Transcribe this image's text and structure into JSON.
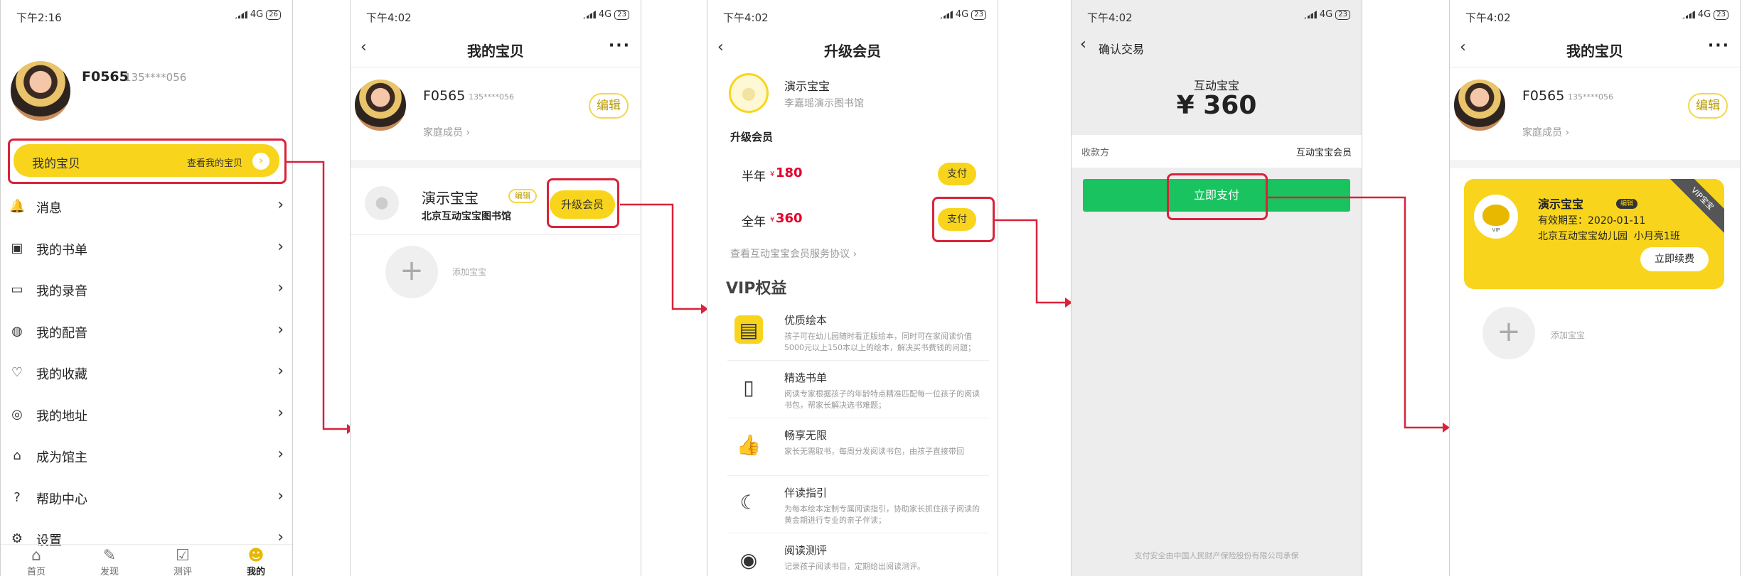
{
  "colors": {
    "accent": "#f8d51c",
    "highlight": "#d8233a",
    "pay": "#19c360",
    "price": "#e4002b"
  },
  "status": {
    "carrier": "4G",
    "s1_time": "下午2:16",
    "s1_battery": "26",
    "time": "下午4:02",
    "battery": "23"
  },
  "s1": {
    "username": "F0565",
    "phone": "135****056",
    "baby_btn": "我的宝贝",
    "baby_link": "查看我的宝贝",
    "menu": [
      {
        "label": "消息",
        "icon": "bell-icon"
      },
      {
        "label": "我的书单",
        "icon": "book-list-icon"
      },
      {
        "label": "我的录音",
        "icon": "recording-icon"
      },
      {
        "label": "我的配音",
        "icon": "dubbing-icon"
      },
      {
        "label": "我的收藏",
        "icon": "favorite-icon"
      },
      {
        "label": "我的地址",
        "icon": "location-icon"
      },
      {
        "label": "成为馆主",
        "icon": "store-icon"
      },
      {
        "label": "帮助中心",
        "icon": "help-icon"
      },
      {
        "label": "设置",
        "icon": "settings-icon"
      }
    ],
    "tabs": [
      "首页",
      "发现",
      "测评",
      "我的"
    ]
  },
  "s2": {
    "title": "我的宝贝",
    "username": "F0565",
    "phone": "135****056",
    "edit": "编辑",
    "family": "家庭成员",
    "baby_name": "演示宝宝",
    "baby_edit": "编辑",
    "baby_school": "北京互动宝宝图书馆",
    "upgrade": "升级会员",
    "add_baby": "添加宝宝"
  },
  "s3": {
    "title": "升级会员",
    "baby_name": "演示宝宝",
    "library": "李嘉瑶演示图书馆",
    "section": "升级会员",
    "half_year": "半年",
    "half_price": "180",
    "year": "全年",
    "year_price": "360",
    "currency": "¥",
    "pay": "支付",
    "agreement": "查看互动宝宝会员服务协议",
    "vip_title": "VIP权益",
    "benefits": [
      {
        "title": "优质绘本",
        "desc": "孩子可在幼儿园随时看正版绘本，同时可在家阅读价值5000元以上150本以上的绘本，解决买书费钱的问题；",
        "icon": "book-icon"
      },
      {
        "title": "精选书单",
        "desc": "阅读专家根据孩子的年龄特点精准匹配每一位孩子的阅读书包，帮家长解决选书难题；",
        "icon": "bookmark-icon"
      },
      {
        "title": "畅享无限",
        "desc": "家长无需取书，每周分发阅读书包，由孩子直接带回",
        "icon": "thumbs-up-icon"
      },
      {
        "title": "伴读指引",
        "desc": "为每本绘本定制专属阅读指引，协助家长抓住孩子阅读的黄金期进行专业的亲子伴读；",
        "icon": "moon-icon"
      },
      {
        "title": "阅读测评",
        "desc": "记录孩子阅读书目，定期给出阅读测评。",
        "icon": "chart-icon"
      }
    ]
  },
  "s4": {
    "title": "确认交易",
    "merchant": "互动宝宝",
    "currency": "¥",
    "amount": "360",
    "payee_label": "收款方",
    "payee": "互动宝宝会员",
    "pay_now": "立即支付",
    "footer": "支付安全由中国人民财产保险股份有限公司承保"
  },
  "s5": {
    "title": "我的宝贝",
    "username": "F0565",
    "phone": "135****056",
    "edit": "编辑",
    "family": "家庭成员",
    "baby_name": "演示宝宝",
    "baby_edit": "编辑",
    "valid": "有效期至：2020-01-11",
    "school": "北京互动宝宝幼儿园",
    "class": "小月亮1班",
    "renew": "立即续费",
    "ribbon": "VIP宝宝",
    "badge": "VIP",
    "add_baby": "添加宝宝"
  }
}
